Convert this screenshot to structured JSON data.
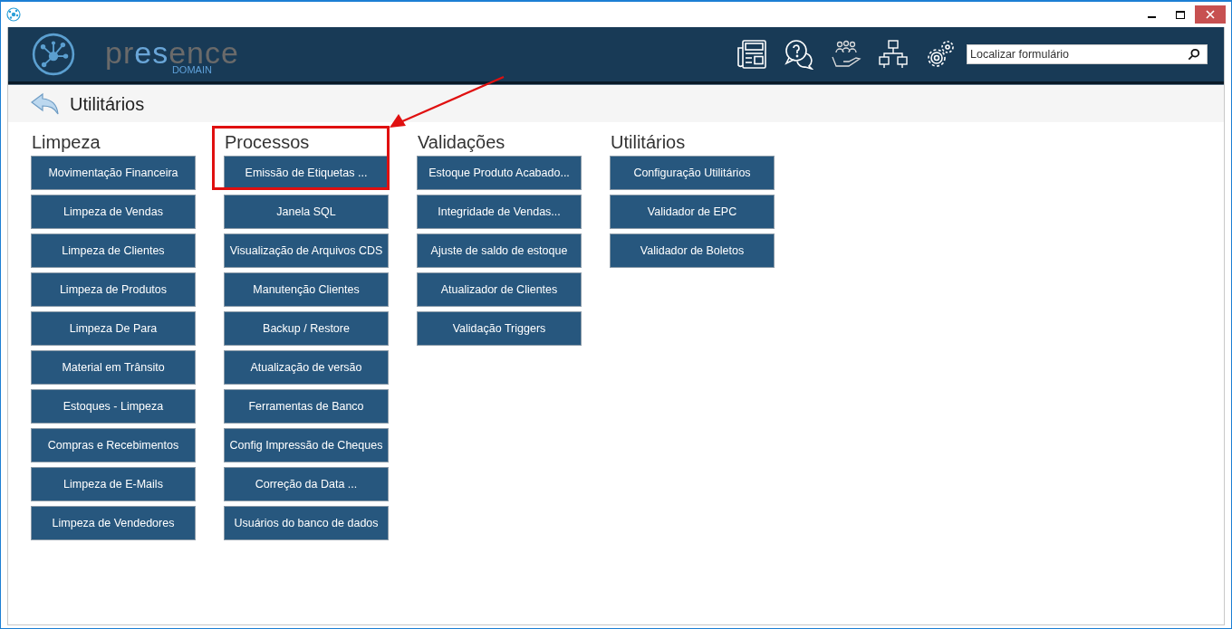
{
  "header": {
    "logo": {
      "parts": [
        {
          "text": "pr",
          "accent": false
        },
        {
          "text": "es",
          "accent": true
        },
        {
          "text": "ence",
          "accent": false
        }
      ],
      "subtitle": "DOMAIN"
    },
    "search": {
      "placeholder": "Localizar formulário"
    }
  },
  "page": {
    "title": "Utilitários"
  },
  "sections": [
    {
      "title": "Limpeza",
      "highlighted": false,
      "buttons": [
        "Movimentação Financeira",
        "Limpeza de Vendas",
        "Limpeza de Clientes",
        "Limpeza de Produtos",
        "Limpeza De Para",
        "Material em Trânsito",
        "Estoques - Limpeza",
        "Compras e Recebimentos",
        "Limpeza de E-Mails",
        "Limpeza de Vendedores"
      ]
    },
    {
      "title": "Processos",
      "highlighted": true,
      "buttons": [
        "Emissão de Etiquetas ...",
        "Janela SQL",
        "Visualização de Arquivos CDS",
        "Manutenção Clientes",
        "Backup / Restore",
        "Atualização de versão",
        "Ferramentas de Banco",
        "Config Impressão de Cheques",
        "Correção da Data ...",
        "Usuários do banco de dados"
      ]
    },
    {
      "title": "Validações",
      "highlighted": false,
      "buttons": [
        "Estoque Produto Acabado...",
        "Integridade de Vendas...",
        "Ajuste de saldo de estoque",
        "Atualizador de Clientes",
        "Validação Triggers"
      ]
    },
    {
      "title": "Utilitários",
      "highlighted": false,
      "buttons": [
        "Configuração Utilitários",
        "Validador de EPC",
        "Validador de Boletos"
      ]
    }
  ]
}
